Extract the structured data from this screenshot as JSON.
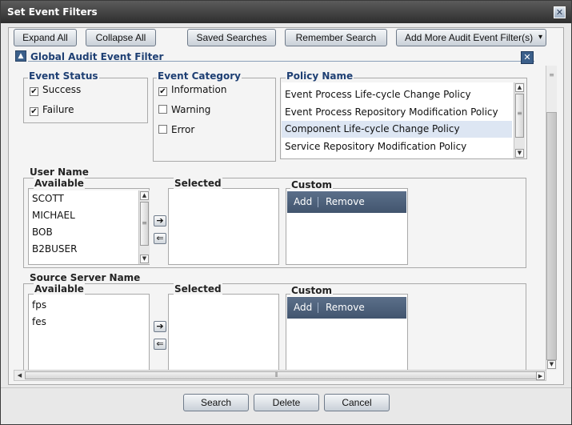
{
  "window": {
    "title": "Set Event Filters",
    "close_glyph": "✕"
  },
  "toolbar": {
    "expand_all": "Expand All",
    "collapse_all": "Collapse All",
    "saved_searches": "Saved Searches",
    "remember_search": "Remember Search",
    "add_more": "Add More Audit Event Filter(s)",
    "add_more_arrow": "▾"
  },
  "group": {
    "title": "Global Audit Event Filter",
    "collapse_glyph": "▲",
    "close_glyph": "✕"
  },
  "event_status": {
    "label": "Event Status",
    "options": [
      {
        "label": "Success",
        "checked": true,
        "mark": "✔"
      },
      {
        "label": "Failure",
        "checked": true,
        "mark": "✔"
      }
    ]
  },
  "event_category": {
    "label": "Event Category",
    "options": [
      {
        "label": "Information",
        "checked": true,
        "mark": "✔"
      },
      {
        "label": "Warning",
        "checked": false,
        "mark": ""
      },
      {
        "label": "Error",
        "checked": false,
        "mark": ""
      }
    ]
  },
  "policy_name": {
    "label": "Policy Name",
    "items": [
      "Event Process Life-cycle Change Policy",
      "Event Process Repository Modification Policy",
      "Component Life-cycle Change Policy",
      "Service Repository Modification Policy"
    ],
    "selected_index": 2
  },
  "user_name": {
    "label": "User Name",
    "available_label": "Available",
    "available": [
      "SCOTT",
      "MICHAEL",
      "BOB",
      "B2BUSER"
    ],
    "selected_label": "Selected",
    "custom_label": "Custom",
    "add": "Add",
    "remove": "Remove",
    "move_right": "➔",
    "move_left": "⇐"
  },
  "source_server": {
    "label": "Source Server Name",
    "available_label": "Available",
    "available": [
      "fps",
      "fes"
    ],
    "selected_label": "Selected",
    "custom_label": "Custom",
    "add": "Add",
    "remove": "Remove",
    "move_right": "➔",
    "move_left": "⇐"
  },
  "scroll": {
    "up": "▲",
    "down": "▼",
    "left": "◀",
    "right": "▶",
    "grip": "≡",
    "hgrip": "⦀"
  },
  "footer": {
    "search": "Search",
    "delete": "Delete",
    "cancel": "Cancel"
  },
  "colors": {
    "accent": "#1e3f73",
    "titlebar": "#3a3a3a",
    "custom_bar": "#4f6380"
  }
}
